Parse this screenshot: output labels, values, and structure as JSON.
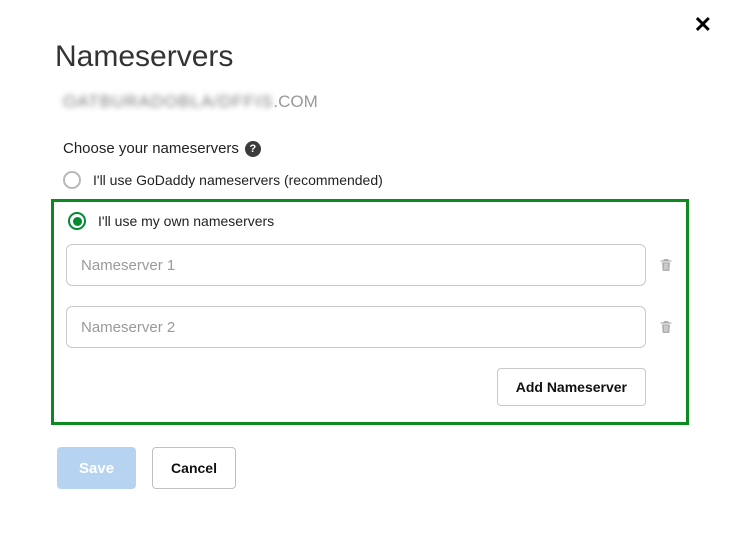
{
  "title": "Nameservers",
  "domain_obscured": "OATBURADOBLA/DFFIS",
  "domain_suffix": ".COM",
  "section_label": "Choose your nameservers",
  "options": {
    "godaddy": "I'll use GoDaddy nameservers (recommended)",
    "own": "I'll use my own nameservers"
  },
  "inputs": {
    "ns1_placeholder": "Nameserver 1",
    "ns2_placeholder": "Nameserver 2"
  },
  "buttons": {
    "add": "Add Nameserver",
    "save": "Save",
    "cancel": "Cancel"
  }
}
